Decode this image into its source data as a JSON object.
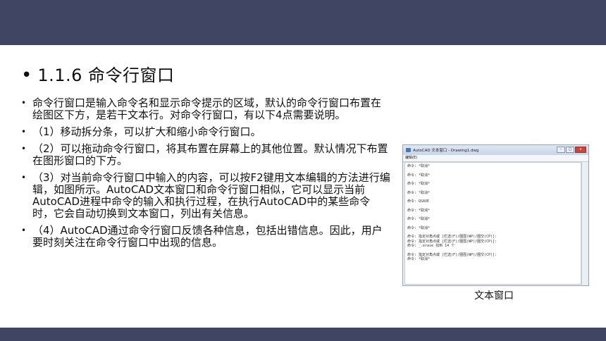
{
  "colors": {
    "band": "#3f4562"
  },
  "section": {
    "bullet": "•",
    "title": "1.1.6  命令行窗口"
  },
  "items": [
    {
      "bullet": "•",
      "text": "命令行窗口是输入命令名和显示命令提示的区域，默认的命令行窗口布置在绘图区下方，是若干文本行。对命令行窗口，有以下4点需要说明。"
    },
    {
      "bullet": "•",
      "text": "（1）移动拆分条，可以扩大和缩小命令行窗口。"
    },
    {
      "bullet": "•",
      "text": "（2）可以拖动命令行窗口，将其布置在屏幕上的其他位置。默认情况下布置在图形窗口的下方。"
    },
    {
      "bullet": "•",
      "text": "（3）对当前命令行窗口中输入的内容，可以按F2键用文本编辑的方法进行编辑，如图所示。AutoCAD文本窗口和命令行窗口相似，它可以显示当前AutoCAD进程中命令的输入和执行过程，在执行AutoCAD中的某些命令时，它会自动切换到文本窗口，列出有关信息。"
    },
    {
      "bullet": "•",
      "text": "（4）AutoCAD通过命令行窗口反馈各种信息，包括出错信息。因此，用户要时刻关注在命令行窗口中出现的信息。"
    }
  ],
  "screenshot": {
    "window_title": "AutoCAD 文本窗口 - Drawing1.dwg",
    "buttons": {
      "minimize": "–",
      "maximize": "□",
      "close": "x"
    },
    "menu": "编辑(E)",
    "lines": [
      "命令: *取消*",
      "命令: *取消*",
      "命令: *取消*",
      "命令: *取消*",
      "命令: QSAVE",
      "命令: *取消*",
      "命令: *取消*",
      "命令: *取消*",
      "命令: 指定对角点或 [栏选(F)/圈围(WP)/圈交(CP)]:",
      "命令: 指定对角点或 [栏选(F)/圈围(WP)/圈交(CP)]:",
      "命令: _.erase 找到 14 个",
      "命令: 指定对角点或 [栏选(F)/圈围(WP)/圈交(CP)]:",
      "命令: *取消*"
    ]
  },
  "caption": "文本窗口"
}
